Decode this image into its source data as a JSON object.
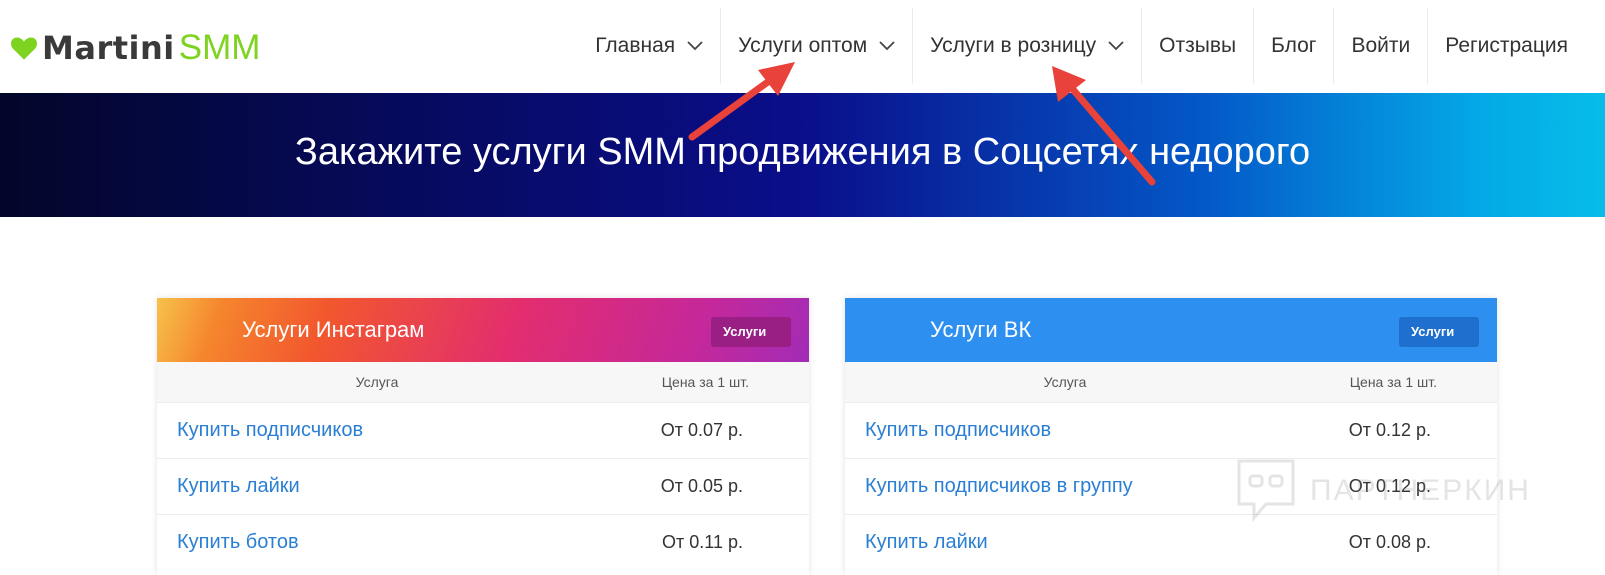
{
  "header": {
    "brand_left": "Martini",
    "brand_right": "SMM",
    "nav": [
      {
        "label": "Главная",
        "dropdown": true
      },
      {
        "label": "Услуги оптом",
        "dropdown": true
      },
      {
        "label": "Услуги в розницу",
        "dropdown": true
      },
      {
        "label": "Отзывы",
        "dropdown": false
      },
      {
        "label": "Блог",
        "dropdown": false
      },
      {
        "label": "Войти",
        "dropdown": false
      },
      {
        "label": "Регистрация",
        "dropdown": false
      }
    ]
  },
  "hero": {
    "title": "Закажите услуги SMM продвижения в Соцсетях недорого"
  },
  "cards": [
    {
      "title": "Услуги Инстаграм",
      "badge": "Услуги",
      "col_service": "Услуга",
      "col_price": "Цена за 1 шт.",
      "rows": [
        {
          "service": "Купить подписчиков",
          "price": "От 0.07 р."
        },
        {
          "service": "Купить лайки",
          "price": "От 0.05 р."
        },
        {
          "service": "Купить ботов",
          "price": "От 0.11 р."
        }
      ]
    },
    {
      "title": "Услуги ВК",
      "badge": "Услуги",
      "col_service": "Услуга",
      "col_price": "Цена за 1 шт.",
      "rows": [
        {
          "service": "Купить подписчиков",
          "price": "От 0.12 р."
        },
        {
          "service": "Купить подписчиков в группу",
          "price": "От 0.12 р."
        },
        {
          "service": "Купить лайки",
          "price": "От 0.08 р."
        }
      ]
    }
  ],
  "watermark": "ПАРТНЕРКИН",
  "colors": {
    "brand_green": "#7ed321",
    "link_blue": "#2a7fd4",
    "vk_blue": "#2d8ff0",
    "arrow_red": "#e8423a"
  },
  "icons": [
    "heart-icon",
    "chevron-down-icon",
    "arrow-annotation"
  ]
}
